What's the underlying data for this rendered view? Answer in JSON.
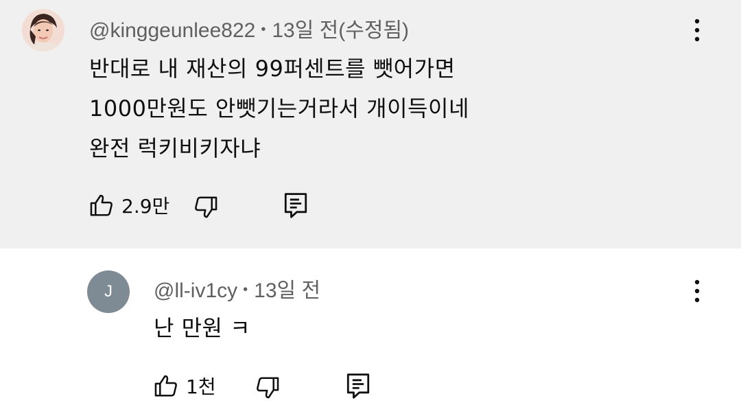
{
  "comment": {
    "author": "@kinggeunlee822",
    "time": "13일 전(수정됨)",
    "separator": "•",
    "lines": [
      "반대로 내 재산의 99퍼센트를 뺏어가면",
      "1000만원도 안뺏기는거라서 개이득이네",
      "완전 럭키비키자냐"
    ],
    "like_count": "2.9만",
    "icons": {
      "like": "thumb-up-icon",
      "dislike": "thumb-down-icon",
      "reply": "reply-comment-icon",
      "menu": "more-vert-icon"
    }
  },
  "reply": {
    "avatar_letter": "J",
    "author": "@ll-iv1cy",
    "time": "13일 전",
    "separator": "•",
    "lines": [
      "난 만원 ㅋ"
    ],
    "like_count": "1천"
  },
  "colors": {
    "highlight_bg": "#f0f0f0",
    "avatar_bg": "#7e8b94",
    "meta_text": "#606060"
  }
}
